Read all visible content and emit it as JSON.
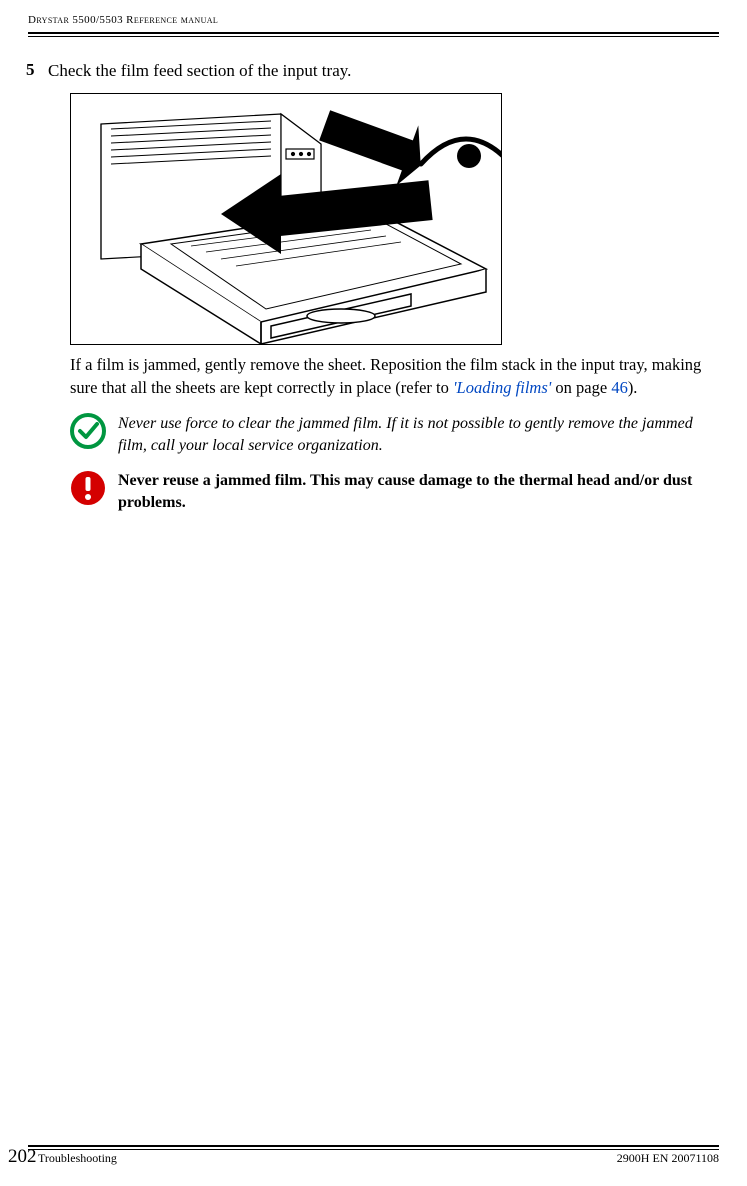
{
  "header": {
    "running_head": "Drystar 5500/5503 Reference manual"
  },
  "step": {
    "number": "5",
    "text": "Check the film feed section of the input tray."
  },
  "body": {
    "para_pre": "If a film is jammed, gently remove the sheet. Reposition the film stack in the input tray, making sure that all the sheets are kept correctly in place (refer to ",
    "link_text": "'Loading films'",
    "para_mid": " on page ",
    "link_page": "46",
    "para_post": ")."
  },
  "note_ok": {
    "text": "Never use force to clear the jammed film. If it is not possible to gently remove the jammed film, call your local service organization."
  },
  "note_warn": {
    "text": "Never reuse a jammed film. This may cause damage to the thermal head and/or dust problems."
  },
  "footer": {
    "page_number": "202",
    "section": "Troubleshooting",
    "doc_id": "2900H EN 20071108"
  }
}
